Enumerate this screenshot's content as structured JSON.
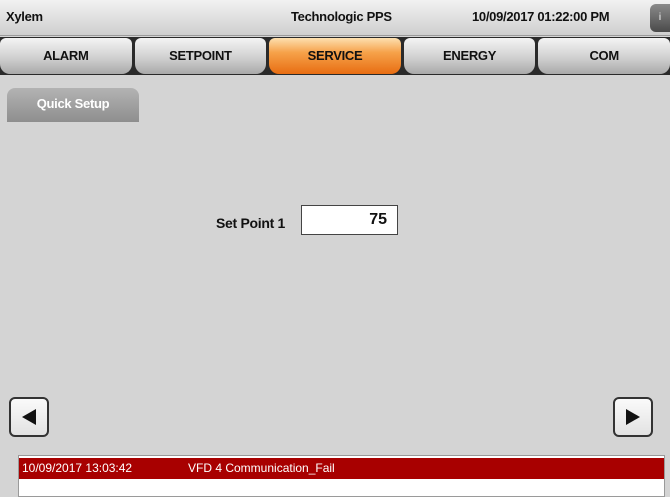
{
  "header": {
    "brand": "Xylem",
    "title": "Technologic PPS",
    "datetime": "10/09/2017 01:22:00 PM",
    "info_label": "i",
    "info_icon": "info-icon"
  },
  "tabs": [
    {
      "label": "ALARM",
      "active": false
    },
    {
      "label": "SETPOINT",
      "active": false
    },
    {
      "label": "SERVICE",
      "active": true
    },
    {
      "label": "ENERGY",
      "active": false
    },
    {
      "label": "COM",
      "active": false
    }
  ],
  "subtab": {
    "label": "Quick Setup"
  },
  "setpoint": {
    "label": "Set Point 1",
    "value": "75"
  },
  "nav": {
    "prev_icon": "triangle-left-icon",
    "next_icon": "triangle-right-icon"
  },
  "alarm": {
    "time": "10/09/2017 13:03:42",
    "message": "VFD 4 Communication_Fail",
    "color": "#a80000"
  },
  "colors": {
    "active_tab": "#f28a2e",
    "background": "#d4d4d4"
  }
}
